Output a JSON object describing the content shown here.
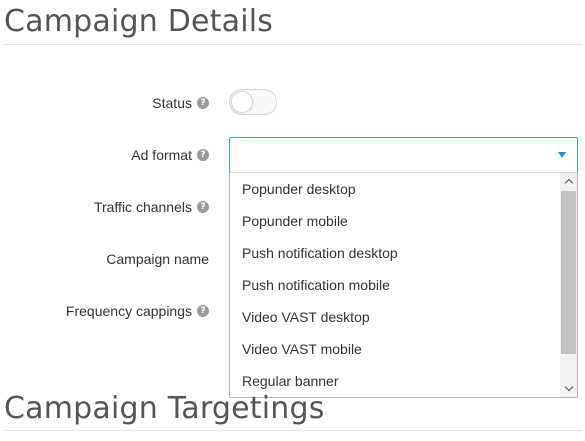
{
  "sections": {
    "details_title": "Campaign Details",
    "targeting_title": "Campaign Targetings"
  },
  "form": {
    "status_label": "Status",
    "ad_format_label": "Ad format",
    "traffic_channels_label": "Traffic channels",
    "campaign_name_label": "Campaign name",
    "frequency_cappings_label": "Frequency cappings",
    "help_glyph": "?",
    "status_on": false
  },
  "ad_format": {
    "selected_value": "",
    "options": [
      "Popunder desktop",
      "Popunder mobile",
      "Push notification desktop",
      "Push notification mobile",
      "Video VAST desktop",
      "Video VAST mobile",
      "Regular banner"
    ]
  },
  "colors": {
    "select_border_focus": "#4aa3d6",
    "caret": "#2d8ec9",
    "help_icon": "#9a9a9a"
  },
  "icons": {
    "help": "question-circle-icon",
    "caret": "caret-down-icon",
    "scroll_up": "chevron-up-icon",
    "scroll_down": "chevron-down-icon"
  }
}
